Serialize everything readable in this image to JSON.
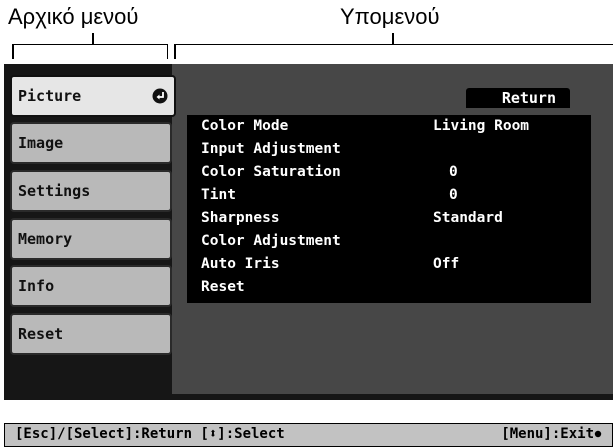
{
  "captions": {
    "main_menu": "Αρχικό μενού",
    "submenu": "Υπομενού"
  },
  "main_menu": {
    "items": [
      {
        "label": "Picture",
        "active": true
      },
      {
        "label": "Image"
      },
      {
        "label": "Settings"
      },
      {
        "label": "Memory"
      },
      {
        "label": "Info"
      },
      {
        "label": "Reset"
      }
    ]
  },
  "submenu": {
    "return_label": "Return",
    "rows": [
      {
        "name": "Color Mode",
        "value": "Living Room"
      },
      {
        "name": "Input Adjustment",
        "value": ""
      },
      {
        "name": "Color Saturation",
        "value": "0"
      },
      {
        "name": "Tint",
        "value": "0"
      },
      {
        "name": "Sharpness",
        "value": "Standard"
      },
      {
        "name": "Color Adjustment",
        "value": ""
      },
      {
        "name": "Auto Iris",
        "value": "Off"
      },
      {
        "name": "Reset",
        "value": ""
      }
    ]
  },
  "help_bar": {
    "left": "[Esc]/[Select]:Return [⬍]:Select",
    "right": "[Menu]:Exit"
  },
  "colors": {
    "screen_bg": "#161616",
    "submenu_bg": "#474747",
    "menu_item_bg": "#b9b9b9",
    "menu_item_active_bg": "#e6e6e6",
    "list_bg": "#000000"
  },
  "icons": {
    "enter": "enter-return-icon",
    "exit": "dot-icon"
  }
}
